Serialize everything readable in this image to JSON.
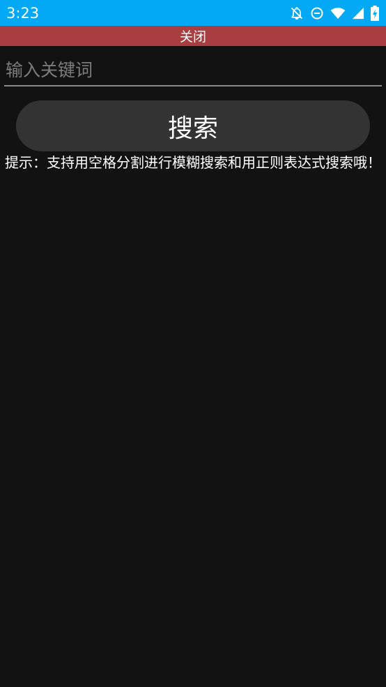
{
  "status_bar": {
    "time": "3:23",
    "icons": [
      "notifications-off-icon",
      "do-not-disturb-icon",
      "wifi-icon",
      "cellular-signal-icon",
      "battery-charging-icon"
    ]
  },
  "close_bar": {
    "label": "关闭",
    "color": "#a83e3f"
  },
  "search": {
    "placeholder": "输入关键词",
    "value": "",
    "button_label": "搜索"
  },
  "hint": {
    "text": "提示：支持用空格分割进行模糊搜索和用正则表达式搜索哦！"
  },
  "colors": {
    "status_bar": "#03a9f4",
    "background": "#121212",
    "button": "#333333"
  }
}
